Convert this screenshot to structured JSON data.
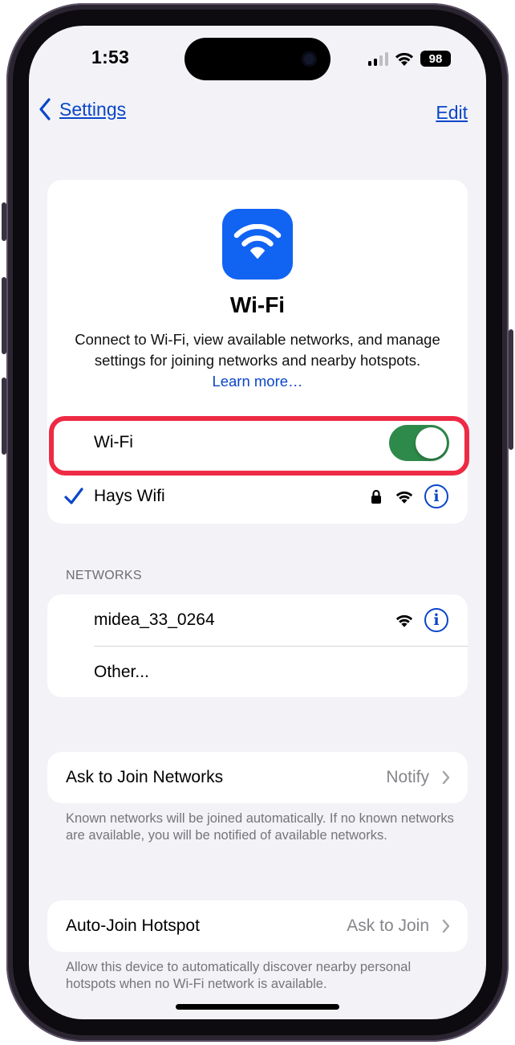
{
  "status_bar": {
    "time": "1:53",
    "battery": "98"
  },
  "nav": {
    "back_label": "Settings",
    "edit_label": "Edit"
  },
  "hero": {
    "icon": "wifi-icon",
    "title": "Wi-Fi",
    "description": "Connect to Wi-Fi, view available networks, and manage settings for joining networks and nearby hotspots.",
    "learn_more": "Learn more…"
  },
  "wifi": {
    "label": "Wi-Fi",
    "enabled": true,
    "toggle_color": "#2e8a4a",
    "highlight_color": "#ee2a44"
  },
  "connected_network": {
    "name": "Hays Wifi",
    "icons": [
      "checkmark-icon",
      "lock-icon",
      "wifi-signal-icon",
      "info-icon"
    ]
  },
  "networks": {
    "header": "NETWORKS",
    "items": [
      {
        "name": "midea_33_0264"
      }
    ],
    "other": "Other..."
  },
  "ask_to_join": {
    "label": "Ask to Join Networks",
    "value": "Notify",
    "footnote": "Known networks will be joined automatically. If no known networks are available, you will be notified of available networks."
  },
  "auto_join": {
    "label": "Auto-Join Hotspot",
    "value": "Ask to Join",
    "footnote": "Allow this device to automatically discover nearby personal hotspots when no Wi-Fi network is available."
  },
  "colors": {
    "accent": "#0a46c8",
    "wifi_icon_bg": "#1163f2"
  }
}
